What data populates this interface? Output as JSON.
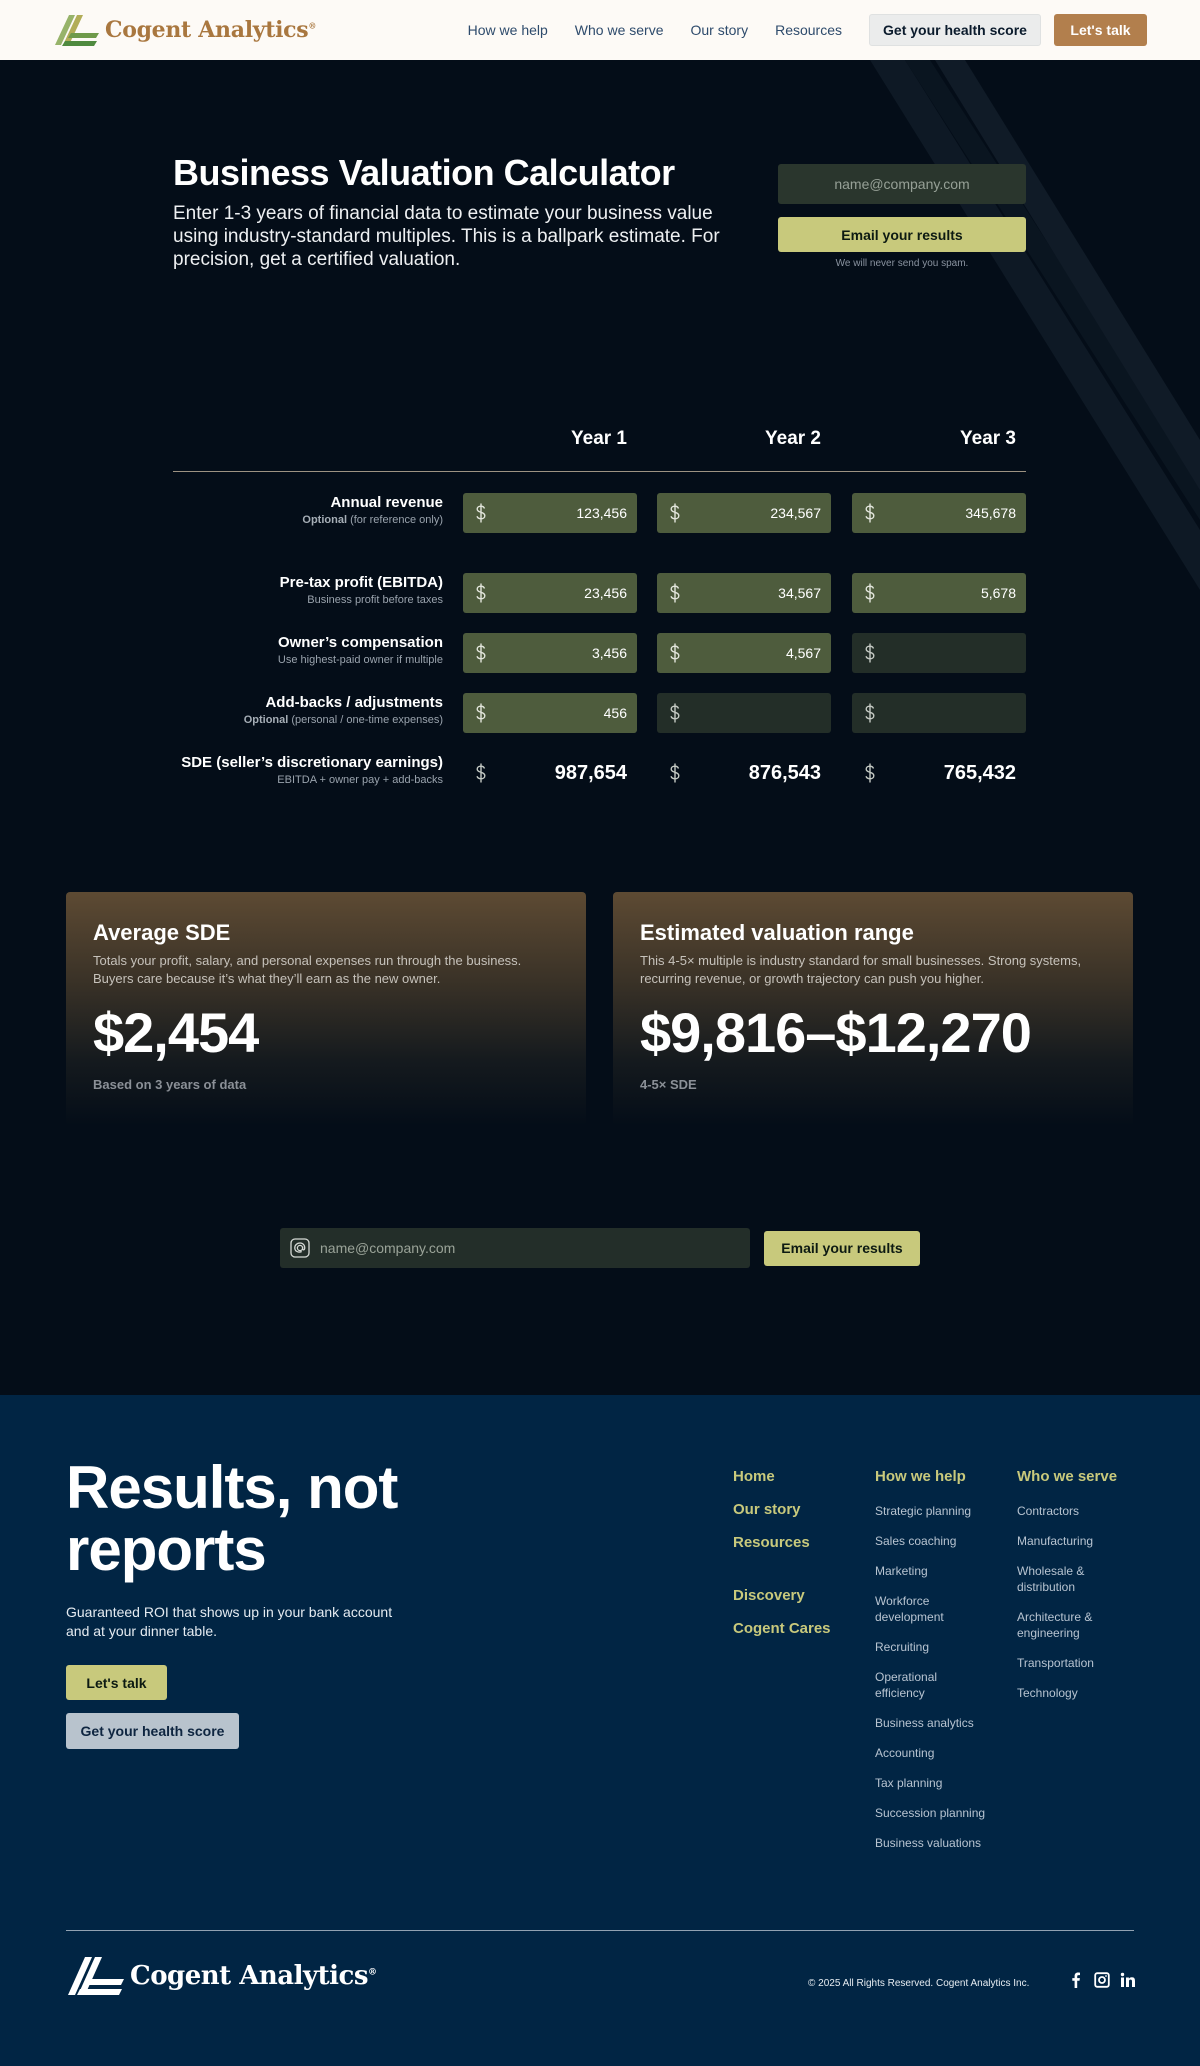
{
  "header": {
    "logo_text": "Cogent Analytics",
    "logo_mark": "®",
    "nav": [
      "How we help",
      "Who we serve",
      "Our story",
      "Resources"
    ],
    "score_button": "Get your health score",
    "talk_button": "Let's talk"
  },
  "hero": {
    "title": "Business Valuation Calculator",
    "subtitle": "Enter 1-3 years of financial data to estimate your business value using industry-standard multiples. This is a ballpark estimate. For precision, get a certified valuation.",
    "email_placeholder": "name@company.com",
    "email_button": "Email your results",
    "email_note": "We will never send you spam."
  },
  "calculator": {
    "years": [
      "Year 1",
      "Year 2",
      "Year 3"
    ],
    "rows": [
      {
        "label": "Annual revenue",
        "sub_bold": "Optional",
        "sub": " (for reference only)",
        "values": [
          "123,456",
          "234,567",
          "345,678"
        ]
      },
      {
        "label": "Pre-tax profit (EBITDA)",
        "sub_bold": "",
        "sub": "Business profit before taxes",
        "values": [
          "23,456",
          "34,567",
          "5,678"
        ]
      },
      {
        "label": "Owner’s compensation",
        "sub_bold": "",
        "sub": "Use highest-paid owner if multiple",
        "values": [
          "3,456",
          "4,567",
          ""
        ]
      },
      {
        "label": "Add-backs / adjustments",
        "sub_bold": "Optional",
        "sub": " (personal / one-time expenses)",
        "values": [
          "456",
          "",
          ""
        ]
      }
    ],
    "total": {
      "label": "SDE (seller’s discretionary earnings)",
      "sub": "EBITDA + owner pay + add-backs",
      "values": [
        "987,654",
        "876,543",
        "765,432"
      ]
    }
  },
  "results": {
    "avg": {
      "title": "Average SDE",
      "desc": "Totals your profit, salary, and personal expenses run through the business. Buyers care because it’s what they’ll earn as the new owner.",
      "value": "$2,454",
      "foot": "Based on 3 years of data"
    },
    "range": {
      "title": "Estimated valuation range",
      "desc": "This 4-5× multiple is industry standard for small businesses. Strong systems, recurring revenue, or growth trajectory can push you higher.",
      "value": "$9,816–$12,270",
      "foot": "4-5× SDE"
    }
  },
  "email_bottom": {
    "placeholder": "name@company.com",
    "button": "Email your results"
  },
  "footer": {
    "tagline_1": "Results, not",
    "tagline_2": "reports",
    "desc": "Guaranteed ROI that shows up in your bank account and at your dinner table.",
    "talk_button": "Let's talk",
    "score_button": "Get your health score",
    "main_links": [
      "Home",
      "Our story",
      "Resources"
    ],
    "extra_links": [
      "Discovery",
      "Cogent Cares"
    ],
    "col_help_title": "How we help",
    "col_help": [
      "Strategic planning",
      "Sales coaching",
      "Marketing",
      "Workforce development",
      "Recruiting",
      "Operational efficiency",
      "Business analytics",
      "Accounting",
      "Tax planning",
      "Succession planning",
      "Business valuations"
    ],
    "col_serve_title": "Who we serve",
    "col_serve": [
      "Contractors",
      "Manufacturing",
      "Wholesale & distribution",
      "Architecture & engineering",
      "Transportation",
      "Technology"
    ],
    "logo_text": "Cogent Analytics",
    "logo_mark": "®",
    "copyright": "© 2025 All Rights Reserved. Cogent Analytics Inc.",
    "social": [
      "facebook-icon",
      "instagram-icon",
      "linkedin-icon"
    ]
  },
  "colors": {
    "accent_green": "#c8c97c",
    "brand_bronze": "#b27f4d",
    "field_filled": "#4e5c3d",
    "field_empty": "#232e28",
    "footer_bg": "#012544"
  }
}
